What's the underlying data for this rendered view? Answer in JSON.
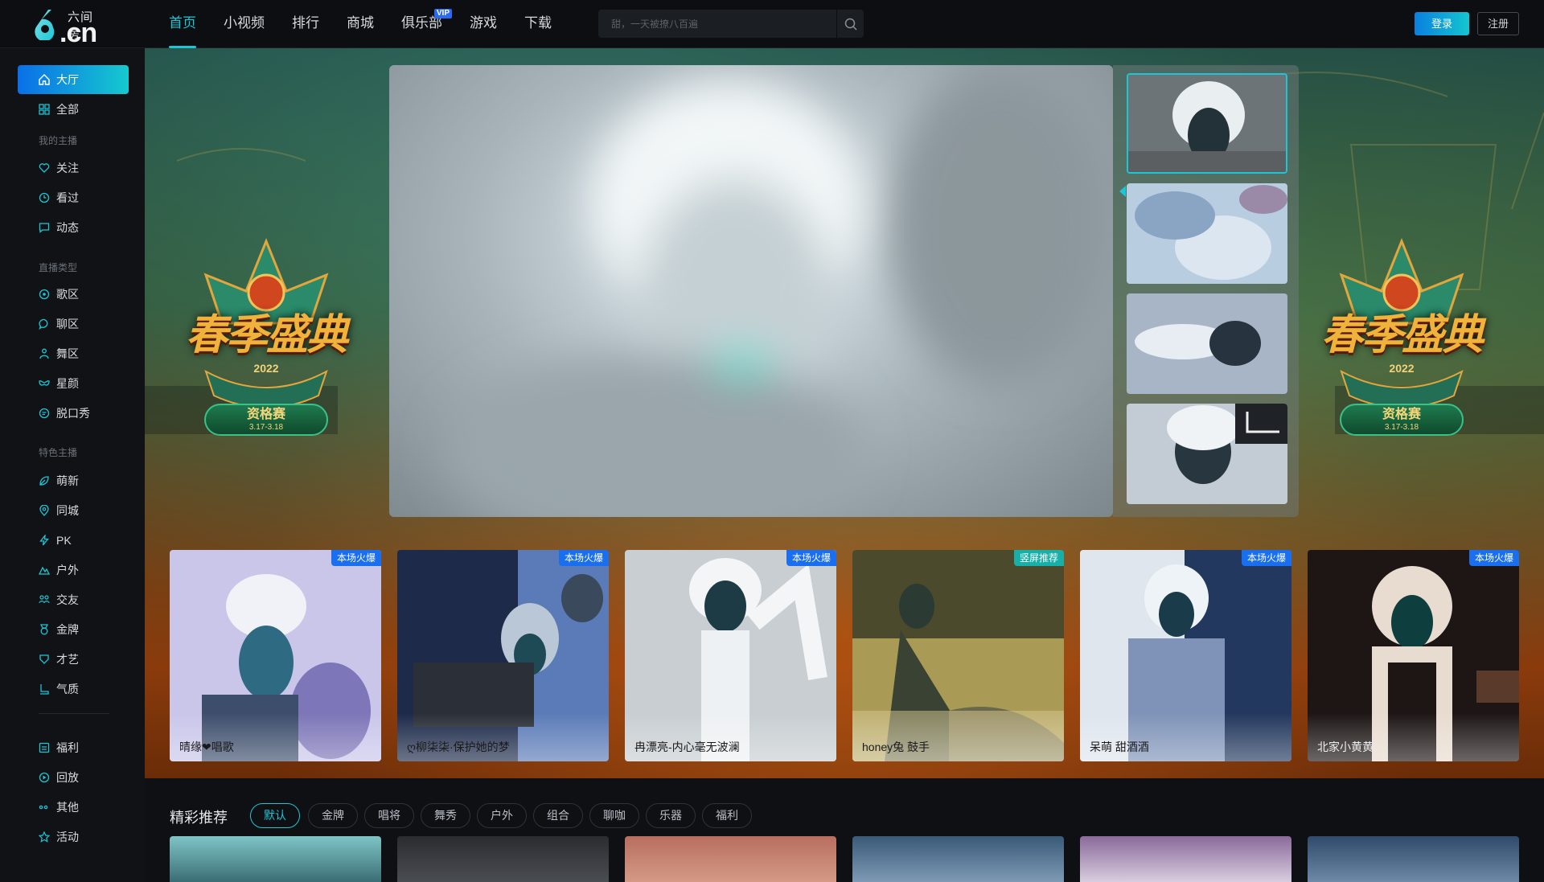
{
  "header": {
    "logo": {
      "top": "六间房",
      "bottom": ".cn"
    },
    "nav": [
      {
        "label": "首页",
        "active": true
      },
      {
        "label": "小视频"
      },
      {
        "label": "排行"
      },
      {
        "label": "商城"
      },
      {
        "label": "俱乐部",
        "badge": "VIP"
      },
      {
        "label": "游戏"
      },
      {
        "label": "下载"
      }
    ],
    "search": {
      "placeholder": "甜，一天被撩八百遍",
      "icon": "search-icon"
    },
    "login": "登录",
    "register": "注册"
  },
  "sidebar": {
    "hall": "大厅",
    "all": "全部",
    "group_my": "我的主播",
    "my": [
      {
        "label": "关注",
        "icon": "heart-icon"
      },
      {
        "label": "看过",
        "icon": "clock-icon"
      },
      {
        "label": "动态",
        "icon": "message-icon"
      }
    ],
    "group_type": "直播类型",
    "types": [
      {
        "label": "歌区",
        "icon": "music-icon"
      },
      {
        "label": "聊区",
        "icon": "chat-icon"
      },
      {
        "label": "舞区",
        "icon": "dance-icon"
      },
      {
        "label": "星颜",
        "icon": "mask-icon"
      },
      {
        "label": "脱口秀",
        "icon": "mic-icon"
      }
    ],
    "group_feature": "特色主播",
    "features": [
      {
        "label": "萌新",
        "icon": "leaf-icon"
      },
      {
        "label": "同城",
        "icon": "location-icon"
      },
      {
        "label": "PK",
        "icon": "lightning-icon"
      },
      {
        "label": "户外",
        "icon": "mountain-icon"
      },
      {
        "label": "交友",
        "icon": "users-icon"
      },
      {
        "label": "金牌",
        "icon": "medal-icon"
      },
      {
        "label": "才艺",
        "icon": "palette-icon"
      },
      {
        "label": "气质",
        "icon": "boot-icon"
      }
    ],
    "extras": [
      {
        "label": "福利",
        "icon": "gift-icon"
      },
      {
        "label": "回放",
        "icon": "replay-icon"
      },
      {
        "label": "其他",
        "icon": "dots-icon"
      },
      {
        "label": "活动",
        "icon": "star-icon"
      }
    ]
  },
  "banner": {
    "emblem_title": "春季盛典",
    "emblem_year": "2022",
    "emblem_pill": "资格赛",
    "emblem_dates": "3.17-3.18"
  },
  "cards": [
    {
      "tag": "本场火爆",
      "name": "晴缘❤唱歌",
      "colors": [
        "#c9c6ea",
        "#7d76b8",
        "#3d4e6c"
      ]
    },
    {
      "tag": "本场火爆",
      "name": "ღ柳柒柒·保护她的梦",
      "colors": [
        "#1d2a4a",
        "#5b7bb8",
        "#b9c7d6"
      ]
    },
    {
      "tag": "本场火爆",
      "name": "冉漂亮-内心毫无波澜",
      "colors": [
        "#dfe3e6",
        "#c8ced2",
        "#1d3b44"
      ]
    },
    {
      "tag": "竖屏推荐",
      "name": "honey兔 鼓手",
      "colors": [
        "#4c4a2c",
        "#a99a55",
        "#d9c993"
      ],
      "alt": true
    },
    {
      "tag": "本场火爆",
      "name": "呆萌 甜酒酒",
      "colors": [
        "#dfe6ee",
        "#7f93b8",
        "#23385e"
      ]
    },
    {
      "tag": "本场火爆",
      "name": "北家小黄黄",
      "colors": [
        "#1d1615",
        "#e8dcd0",
        "#0e3e3e"
      ]
    }
  ],
  "featured": {
    "title": "精彩推荐",
    "filters": [
      {
        "label": "默认",
        "active": true
      },
      {
        "label": "金牌"
      },
      {
        "label": "唱将"
      },
      {
        "label": "舞秀"
      },
      {
        "label": "户外"
      },
      {
        "label": "组合"
      },
      {
        "label": "聊咖"
      },
      {
        "label": "乐器"
      },
      {
        "label": "福利"
      }
    ]
  },
  "colors": {
    "accent": "#19c7d6",
    "brand_blue": "#1a6ff0"
  }
}
